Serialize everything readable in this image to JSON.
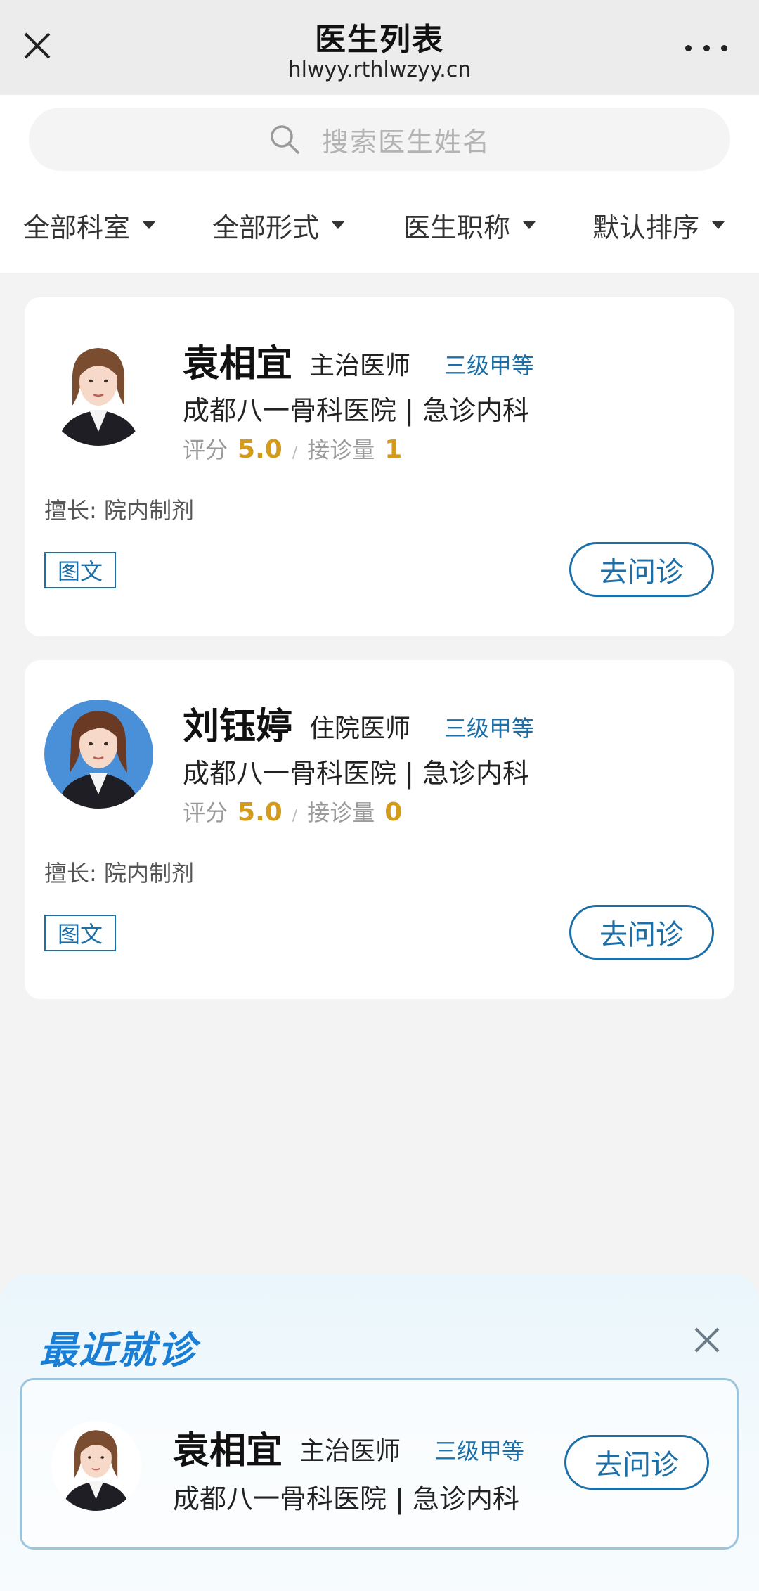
{
  "topbar": {
    "title": "医生列表",
    "url": "hlwyy.rthlwzyy.cn",
    "close_icon": "close-icon",
    "more_icon": "more-dots-icon"
  },
  "search": {
    "placeholder": "搜索医生姓名",
    "icon": "search-icon"
  },
  "filters": [
    {
      "label": "全部科室"
    },
    {
      "label": "全部形式"
    },
    {
      "label": "医生职称"
    },
    {
      "label": "默认排序"
    }
  ],
  "doctors": [
    {
      "name": "袁相宜",
      "title": "主治医师",
      "level": "三级甲等",
      "hospital": "成都八一骨科医院 | 急诊内科",
      "rating_label": "评分",
      "rating": "5.0",
      "separator": "/",
      "count_label": "接诊量",
      "count": "1",
      "skill": "擅长: 院内制剂",
      "tag": "图文",
      "button": "去问诊"
    },
    {
      "name": "刘钰婷",
      "title": "住院医师",
      "level": "三级甲等",
      "hospital": "成都八一骨科医院 | 急诊内科",
      "rating_label": "评分",
      "rating": "5.0",
      "separator": "/",
      "count_label": "接诊量",
      "count": "0",
      "skill": "擅长: 院内制剂",
      "tag": "图文",
      "button": "去问诊"
    }
  ],
  "recent": {
    "title": "最近就诊",
    "close_icon": "close-icon",
    "doctor": {
      "name": "袁相宜",
      "title": "主治医师",
      "level": "三级甲等",
      "hospital": "成都八一骨科医院 | 急诊内科",
      "button": "去问诊"
    }
  },
  "colors": {
    "accent": "#1d6fa8",
    "rating": "#d49a1a",
    "recent_title": "#1a7fd4"
  }
}
